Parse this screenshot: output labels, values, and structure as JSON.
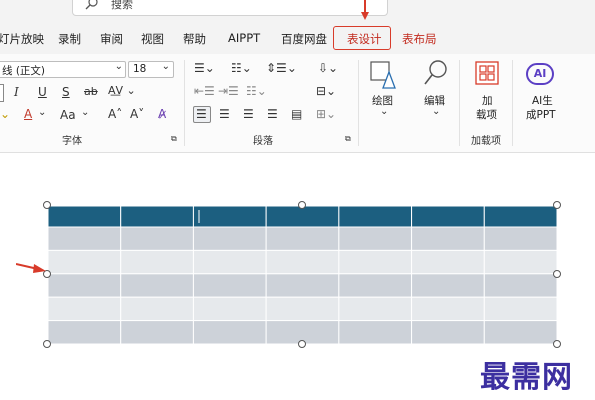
{
  "search": {
    "placeholder": "搜索"
  },
  "tabs": [
    {
      "label": "灯片放映"
    },
    {
      "label": "录制"
    },
    {
      "label": "审阅"
    },
    {
      "label": "视图"
    },
    {
      "label": "帮助"
    },
    {
      "label": "AIPPT"
    },
    {
      "label": "百度网盘"
    },
    {
      "label": "表设计",
      "active": true
    },
    {
      "label": "表布局"
    }
  ],
  "font_group": {
    "font_name": "线 (正文)",
    "font_size": "18",
    "label": "字体",
    "case_label": "Aa"
  },
  "paragraph_group": {
    "label": "段落"
  },
  "drawing": {
    "label": "绘图"
  },
  "editing": {
    "label": "编辑"
  },
  "addins": {
    "button_line1": "加",
    "button_line2": "载项",
    "label": "加载项"
  },
  "ai": {
    "icon_text": "AI",
    "line1": "AI生",
    "line2": "成PPT"
  },
  "table": {
    "rows": 6,
    "cols": 7
  },
  "watermark": "最需网",
  "colors": {
    "accent_red": "#d83b2a",
    "header_row": "#1c5f80",
    "row_dark": "#cdd2d9",
    "row_light": "#e6e9ec"
  }
}
